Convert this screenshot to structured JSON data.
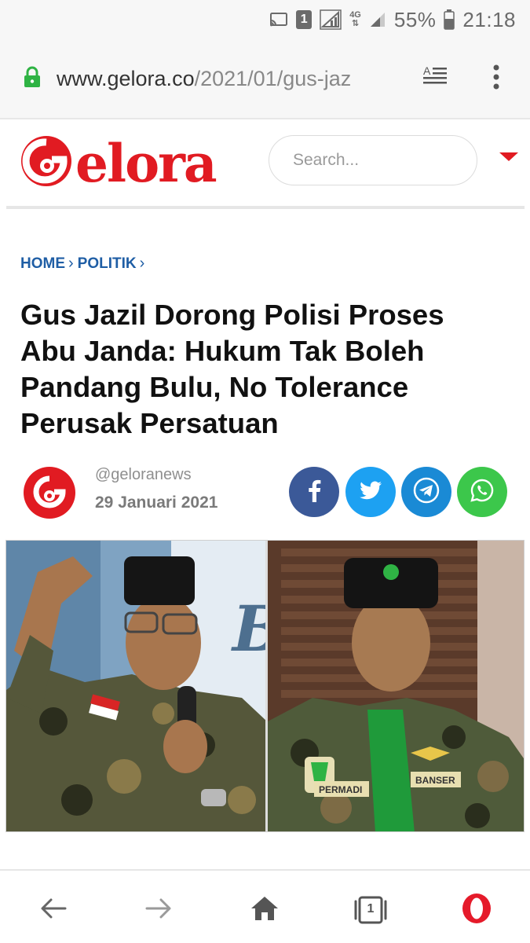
{
  "status_bar": {
    "sim_badge": "1",
    "network": "4G",
    "battery": "55%",
    "time": "21:18"
  },
  "browser": {
    "url_host": "www.gelora.co",
    "url_path": "/2021/01/gus-jaz",
    "tab_count": "1"
  },
  "site": {
    "logo_text": "elora",
    "search_placeholder": "Search...",
    "brand_color": "#e11b22"
  },
  "breadcrumb": {
    "home": "HOME",
    "section": "POLITIK"
  },
  "article": {
    "title_lines": [
      "Gus Jazil Dorong Polisi Proses",
      "Abu Janda: Hukum Tak Boleh",
      "Pandang Bulu, No Tolerance",
      "Perusak Persatuan"
    ],
    "author": "@geloranews",
    "date": "29 Januari 2021",
    "image_labels": {
      "left_badge": "",
      "right_name_tag": "PERMADI",
      "right_org_tag": "BANSER"
    }
  },
  "share": {
    "buttons": [
      "facebook-icon",
      "twitter-icon",
      "telegram-icon",
      "whatsapp-icon"
    ]
  },
  "icons": {
    "status": [
      "cast-icon",
      "sim-icon",
      "signal-icon",
      "battery-icon"
    ],
    "url": [
      "lock-icon",
      "reader-mode-icon",
      "overflow-menu-icon"
    ],
    "bottom_nav": [
      "back-icon",
      "forward-icon",
      "home-icon",
      "tabs-icon",
      "opera-icon"
    ]
  }
}
